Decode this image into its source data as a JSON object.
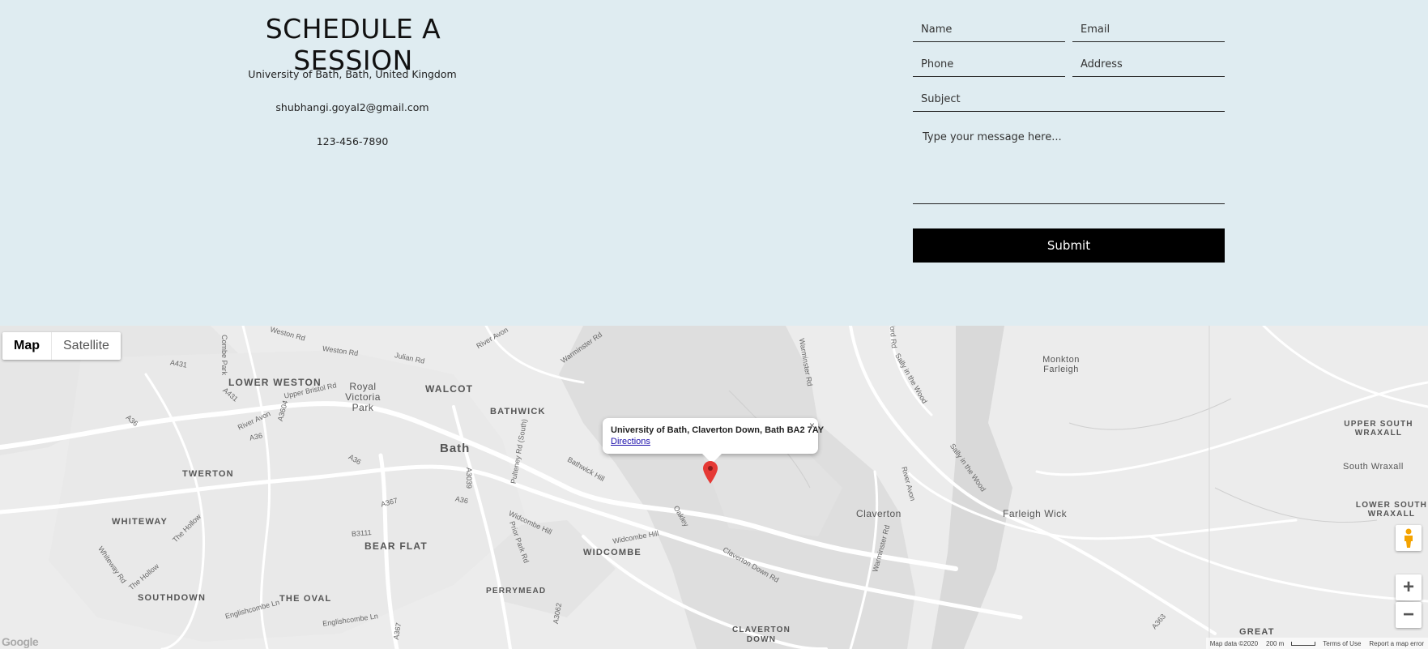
{
  "contact": {
    "title": "SCHEDULE A SESSION",
    "address": "University of Bath, Bath, United Kingdom",
    "email": "shubhangi.goyal2@gmail.com",
    "phone": "123-456-7890"
  },
  "form": {
    "name_placeholder": "Name",
    "email_placeholder": "Email",
    "phone_placeholder": "Phone",
    "address_placeholder": "Address",
    "subject_placeholder": "Subject",
    "message_placeholder": "Type your message here...",
    "submit_label": "Submit"
  },
  "map": {
    "type_control": {
      "map": "Map",
      "satellite": "Satellite"
    },
    "popup": {
      "title": "University of Bath, Claverton Down, Bath BA2 7AY",
      "link": "Directions",
      "close": "×"
    },
    "controls": {
      "zoom_in": "+",
      "zoom_out": "−"
    },
    "logo": "Google",
    "footer": {
      "map_data": "Map data ©2020",
      "scale": "200 m",
      "terms": "Terms of Use",
      "report": "Report a map error"
    },
    "labels": {
      "lower_weston": "LOWER WESTON",
      "royal_victoria_park": "Royal Victoria Park",
      "walcot": "WALCOT",
      "bathwick": "BATHWICK",
      "bath": "Bath",
      "twerton": "TWERTON",
      "whiteway": "WHITEWAY",
      "bear_flat": "BEAR FLAT",
      "widcombe": "WIDCOMBE",
      "southdown": "SOUTHDOWN",
      "the_oval": "THE OVAL",
      "perrymead": "PERRYMEAD",
      "claverton_down": "CLAVERTON DOWN",
      "claverton": "Claverton",
      "farleigh_wick": "Farleigh Wick",
      "monkton_farleigh": "Monkton Farleigh",
      "upper_south_wraxall": "UPPER SOUTH WRAXALL",
      "south_wraxall": "South Wraxall",
      "lower_south_wraxall": "LOWER SOUTH WRAXALL",
      "great": "GREAT",
      "weston_rd_1": "Weston Rd",
      "weston_rd_2": "Weston Rd",
      "julian_rd": "Julian Rd",
      "river_avon_1": "River Avon",
      "warminster_rd_1": "Warminster Rd",
      "combe_park": "Combe Park",
      "a431_1": "A431",
      "a431_2": "A431",
      "upper_bristol_rd": "Upper Bristol Rd",
      "a36_1": "A36",
      "river_avon_2": "River Avon",
      "a36_2": "A36",
      "a3604": "A3604",
      "a36_3": "A36",
      "a36_4": "A36",
      "a367": "A367",
      "a3039": "A3039",
      "pulteney_rd": "Pulteney Rd (South)",
      "bathwick_hill": "Bathwick Hill",
      "widcombe_hill_1": "Widcombe Hill",
      "widcombe_hill_2": "Widcombe Hill",
      "prior_park_rd": "Prior Park Rd",
      "b3111": "B3111",
      "the_hollow_1": "The Hollow",
      "the_hollow_2": "The Hollow",
      "whiteway_rd": "Whiteway Rd",
      "englishcombe_ln_1": "Englishcombe Ln",
      "englishcombe_ln_2": "Englishcombe Ln",
      "a367_2": "A367",
      "a3062": "A3062",
      "oakley": "Oakley",
      "claverton_down_rd": "Claverton Down Rd",
      "warminster_rd_2": "Warminster Rd",
      "warminster_rd_3": "Warminster Rd",
      "ford_rd": "ford Rd",
      "sally_in_the_wood_1": "Sally in the Wood",
      "sally_in_the_wood_2": "Sally in the Wood",
      "river_avon_3": "River Avon",
      "a363": "A363"
    }
  }
}
